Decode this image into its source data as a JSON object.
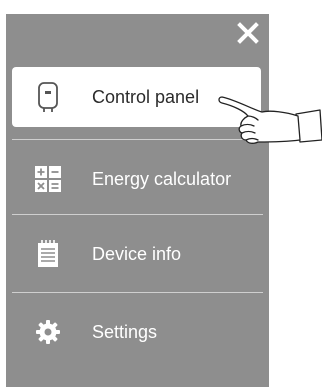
{
  "menu": {
    "close_icon": "close-icon",
    "items": [
      {
        "label": "Control panel",
        "icon": "water-heater-icon",
        "active": true
      },
      {
        "label": "Energy calculator",
        "icon": "calculator-icon",
        "active": false
      },
      {
        "label": "Device info",
        "icon": "document-icon",
        "active": false
      },
      {
        "label": "Settings",
        "icon": "gear-icon",
        "active": false
      }
    ]
  },
  "colors": {
    "panel_bg": "#8e8e8e",
    "active_bg": "#ffffff",
    "text": "#ffffff",
    "active_text": "#2b2b2b",
    "divider": "#cfcfcf"
  }
}
